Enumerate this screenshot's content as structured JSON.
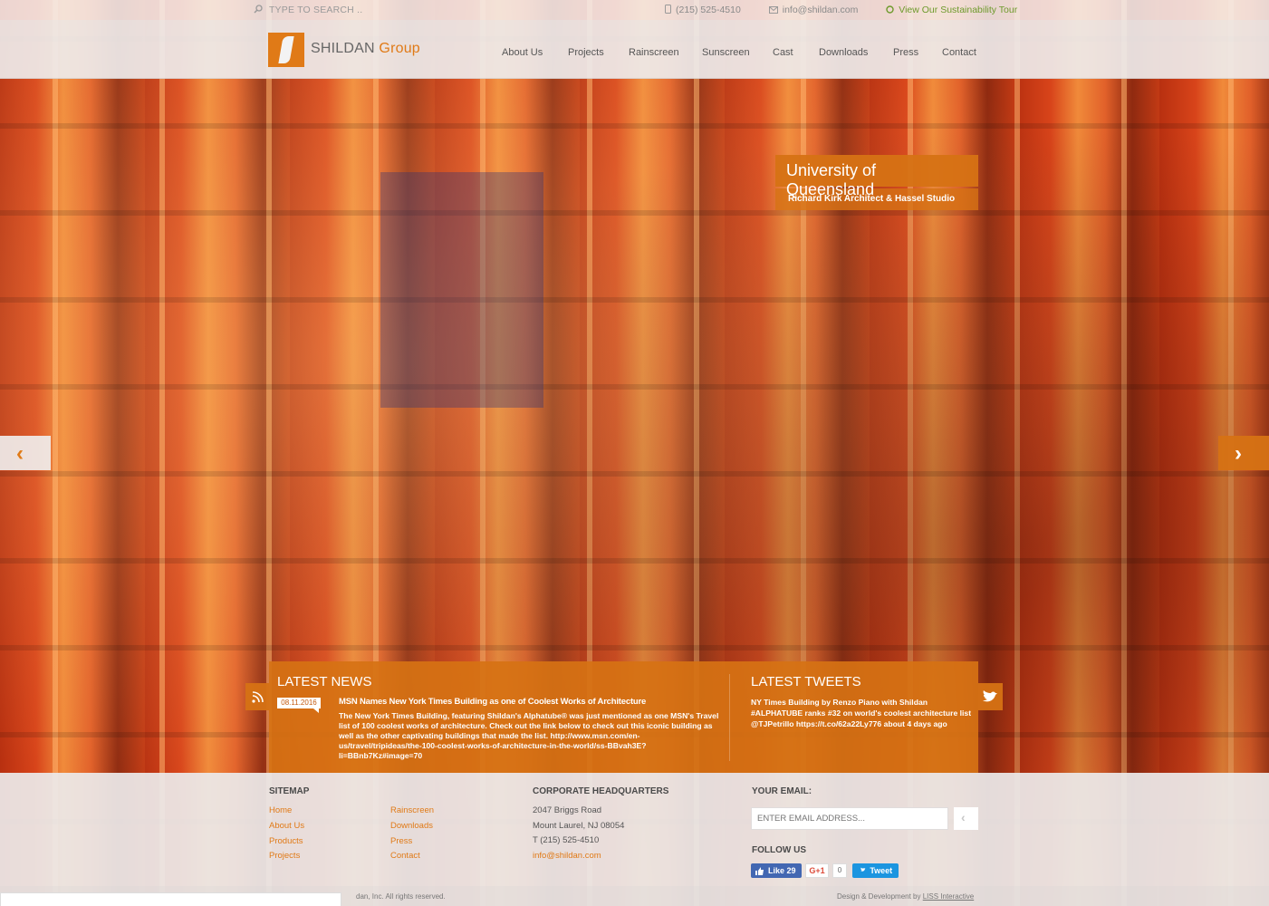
{
  "top": {
    "search_placeholder": "TYPE TO SEARCH ..",
    "phone": "(215) 525-4510",
    "email": "info@shildan.com",
    "tour_link": "View Our Sustainability Tour"
  },
  "brand": {
    "name": "SHILDAN",
    "group": "Group",
    "accent": "#e07a17"
  },
  "nav": [
    "About Us",
    "Projects",
    "Rainscreen",
    "Sunscreen",
    "Cast",
    "Downloads",
    "Press",
    "Contact"
  ],
  "slide": {
    "title": "University of Queensland",
    "subtitle": "Richard Kirk Architect & Hassel Studio"
  },
  "arrows": {
    "prev": "‹",
    "next": "›"
  },
  "news": {
    "heading": "LATEST NEWS",
    "date": "08.11.2016",
    "headline": "MSN Names New York Times Building as one of Coolest Works of Architecture",
    "body": "The New York Times Building, featuring Shildan's Alphatube® was just mentioned as one MSN's Travel list of 100 coolest works of architecture. Check out the link below to check out this iconic building as well as the other captivating buildings that made the list.   http://www.msn.com/en-us/travel/tripideas/the-100-coolest-works-of-architecture-in-the-world/ss-BBvah3E?li=BBnb7Kz#image=70"
  },
  "tweets": {
    "heading": "LATEST TWEETS",
    "text": "NY Times Building by Renzo Piano with Shildan #ALPHATUBE ranks #32 on world's coolest architecture list @TJPetrillo https://t.co/62a22Ly776 about 4 days ago"
  },
  "footer": {
    "sitemap_heading": "SITEMAP",
    "sitemap_col1": [
      "Home",
      "About Us",
      "Products",
      "Projects"
    ],
    "sitemap_col2": [
      "Rainscreen",
      "Downloads",
      "Press",
      "Contact"
    ],
    "hq_heading": "CORPORATE HEADQUARTERS",
    "hq_lines": [
      "2047 Briggs Road",
      "Mount Laurel, NJ 08054",
      "T (215) 525-4510"
    ],
    "hq_email": "info@shildan.com",
    "email_heading": "YOUR EMAIL:",
    "email_placeholder": "ENTER EMAIL ADDRESS...",
    "follow_heading": "FOLLOW US",
    "like_label": "Like 29",
    "gplus_label": "G+1",
    "gplus_count": "0",
    "tweet_label": "Tweet",
    "copyright": "dan, Inc. All rights reserved.",
    "credit_prefix": "Design & Development by ",
    "credit_link": "LISS Interactive"
  }
}
